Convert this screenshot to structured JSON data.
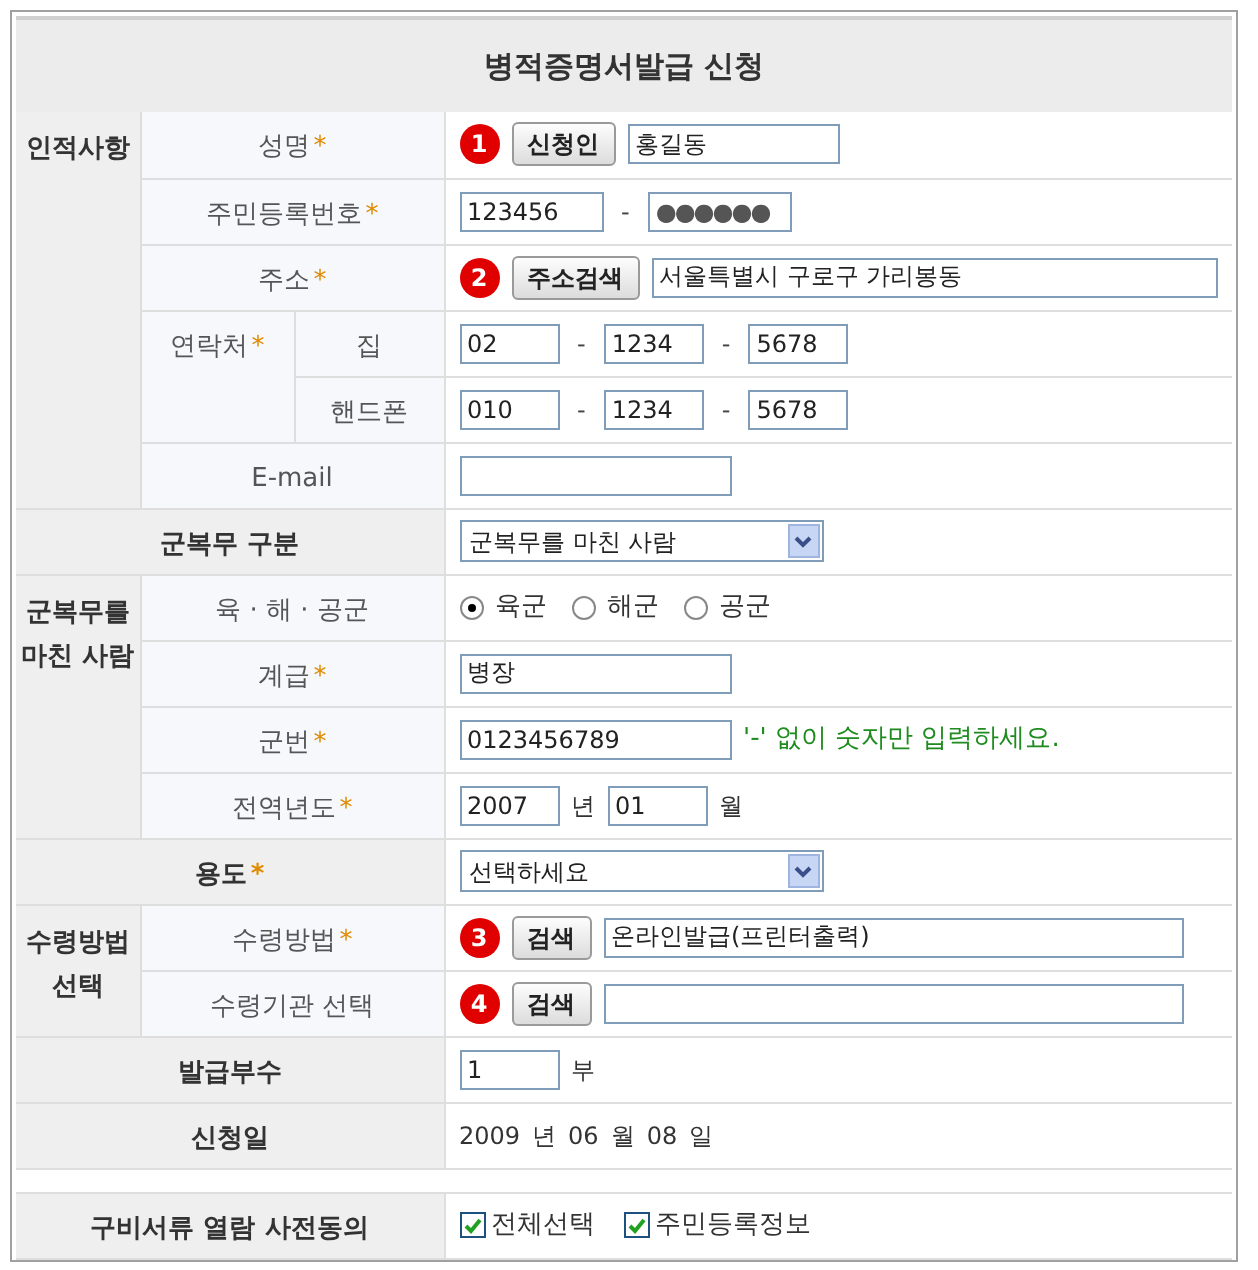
{
  "title": "병적증명서발급 신청",
  "sections": [
    {
      "kind": "group",
      "label": "인적사항",
      "rows": [
        {
          "label": "성명",
          "mark": "*",
          "fields": [
            {
              "kind": "step",
              "text": "1"
            },
            {
              "kind": "button",
              "text": "신청인"
            },
            {
              "kind": "medium",
              "value": "홍길동"
            }
          ]
        },
        {
          "label": "주민등록번호",
          "mark": "*",
          "fields": [
            {
              "kind": "short",
              "value": "123456"
            },
            {
              "kind": "sep",
              "text": "-"
            },
            {
              "kind": "secret",
              "value": "●●●●●●"
            }
          ]
        },
        {
          "label": "주소",
          "mark": "*",
          "fields": [
            {
              "kind": "step",
              "text": "2"
            },
            {
              "kind": "button",
              "text": "주소검색"
            },
            {
              "kind": "long",
              "value": "서울특별시 구로구 가리봉동"
            }
          ]
        },
        {
          "label": "연락처",
          "mark": "*",
          "children": [
            {
              "label": "집",
              "fields": [
                {
                  "kind": "tiny",
                  "value": "02"
                },
                {
                  "kind": "sep",
                  "text": "-"
                },
                {
                  "kind": "tiny",
                  "value": "1234"
                },
                {
                  "kind": "sep",
                  "text": "-"
                },
                {
                  "kind": "tiny",
                  "value": "5678"
                }
              ]
            },
            {
              "label": "핸드폰",
              "fields": [
                {
                  "kind": "tiny",
                  "value": "010"
                },
                {
                  "kind": "sep",
                  "text": "-"
                },
                {
                  "kind": "tiny",
                  "value": "1234"
                },
                {
                  "kind": "sep",
                  "text": "-"
                },
                {
                  "kind": "tiny",
                  "value": "5678"
                }
              ]
            }
          ]
        },
        {
          "label": "E-mail",
          "fields": [
            {
              "kind": "field"
            }
          ]
        }
      ]
    },
    {
      "kind": "single",
      "label": "군복무 구분",
      "fields": [
        {
          "kind": "select",
          "value": "군복무를 마친 사람"
        }
      ]
    },
    {
      "kind": "group",
      "label": "군복무를 마친 사람",
      "rows": [
        {
          "label": "육 · 해 · 공군",
          "fields": [
            {
              "kind": "radio",
              "text": "육군",
              "selected": true
            },
            {
              "kind": "radio",
              "text": "해군",
              "selected": false
            },
            {
              "kind": "radio",
              "text": "공군",
              "selected": false
            }
          ]
        },
        {
          "label": "계급",
          "mark": "*",
          "fields": [
            {
              "kind": "field",
              "value": "병장"
            }
          ]
        },
        {
          "label": "군번",
          "mark": "*",
          "fields": [
            {
              "kind": "field",
              "value": "0123456789"
            },
            {
              "kind": "hint",
              "text": "'-' 없이 숫자만 입력하세요."
            }
          ]
        },
        {
          "label": "전역년도",
          "mark": "*",
          "fields": [
            {
              "kind": "tiny",
              "value": "2007"
            },
            {
              "kind": "unit",
              "text": "년"
            },
            {
              "kind": "tiny",
              "value": "01"
            },
            {
              "kind": "unit",
              "text": "월"
            }
          ]
        }
      ]
    },
    {
      "kind": "single",
      "label": "용도",
      "mark": "*",
      "fields": [
        {
          "kind": "select",
          "value": "선택하세요"
        }
      ]
    },
    {
      "kind": "group",
      "label": "수령방법 선택",
      "rows": [
        {
          "label": "수령방법",
          "mark": "*",
          "fields": [
            {
              "kind": "step",
              "text": "3"
            },
            {
              "kind": "button",
              "text": "검색"
            },
            {
              "kind": "long",
              "value": "온라인발급(프린터출력)"
            }
          ]
        },
        {
          "label": "수령기관 선택",
          "fields": [
            {
              "kind": "step",
              "text": "4"
            },
            {
              "kind": "button",
              "text": "검색"
            },
            {
              "kind": "long"
            }
          ]
        }
      ]
    },
    {
      "kind": "single",
      "label": "발급부수",
      "fields": [
        {
          "kind": "tiny",
          "value": "1"
        },
        {
          "kind": "unit",
          "text": "부"
        }
      ]
    },
    {
      "kind": "single",
      "label": "신청일",
      "fields": [
        {
          "kind": "unit",
          "text": "2009"
        },
        {
          "kind": "unit",
          "text": "년"
        },
        {
          "kind": "unit",
          "text": "06"
        },
        {
          "kind": "unit",
          "text": "월"
        },
        {
          "kind": "unit",
          "text": "08"
        },
        {
          "kind": "unit",
          "text": "일"
        }
      ]
    },
    {
      "kind": "gap"
    },
    {
      "kind": "single",
      "label": "구비서류 열람 사전동의",
      "fields": [
        {
          "kind": "check",
          "text": "전체선택",
          "checked": true
        },
        {
          "kind": "check",
          "text": "주민등록정보",
          "checked": true
        }
      ]
    }
  ]
}
